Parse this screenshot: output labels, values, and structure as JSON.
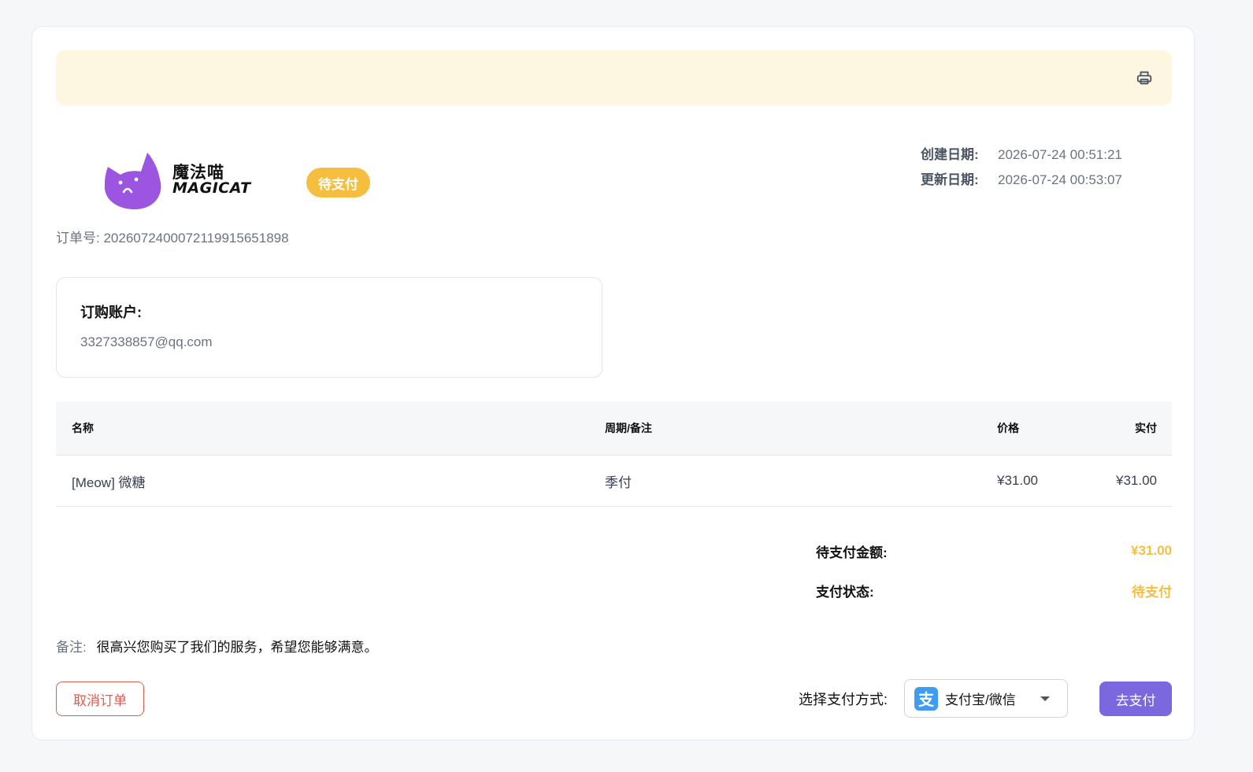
{
  "header": {
    "print_icon": "printer-icon"
  },
  "brand": {
    "name_cn": "魔法喵",
    "name_en": "MAGICAT",
    "logo_color": "#9b55e0"
  },
  "order": {
    "status": "待支付",
    "order_no_label": "订单号:",
    "order_no": "20260724000721199156518​98",
    "created_label": "创建日期:",
    "created_value": "2026-07-24 00:51:21",
    "updated_label": "更新日期:",
    "updated_value": "2026-07-24 00:53:07"
  },
  "account": {
    "title": "订购账户:",
    "email": "3327338857@qq.com"
  },
  "table": {
    "headers": [
      "名称",
      "周期/备注",
      "价格",
      "实付"
    ],
    "rows": [
      [
        "[Meow] 微糖",
        "季付",
        "¥31.00",
        "¥31.00"
      ]
    ]
  },
  "summary": {
    "amount_label": "待支付金额:",
    "amount_value": "¥31.00",
    "status_label": "支付状态:",
    "status_value": "待支付"
  },
  "note": {
    "label": "备注:",
    "text": "很高兴您购买了我们的服务，希望您能够满意。"
  },
  "actions": {
    "cancel_label": "取消订单",
    "pay_method_label": "选择支付方式:",
    "pay_method_selected": "支付宝/微信",
    "pay_method_icon": "alipay-icon",
    "go_pay_label": "去支付"
  },
  "colors": {
    "accent_yellow": "#f5be3f",
    "primary_purple": "#7b68de",
    "danger_red": "#e05a4e",
    "banner_bg": "#fdf6e0"
  }
}
